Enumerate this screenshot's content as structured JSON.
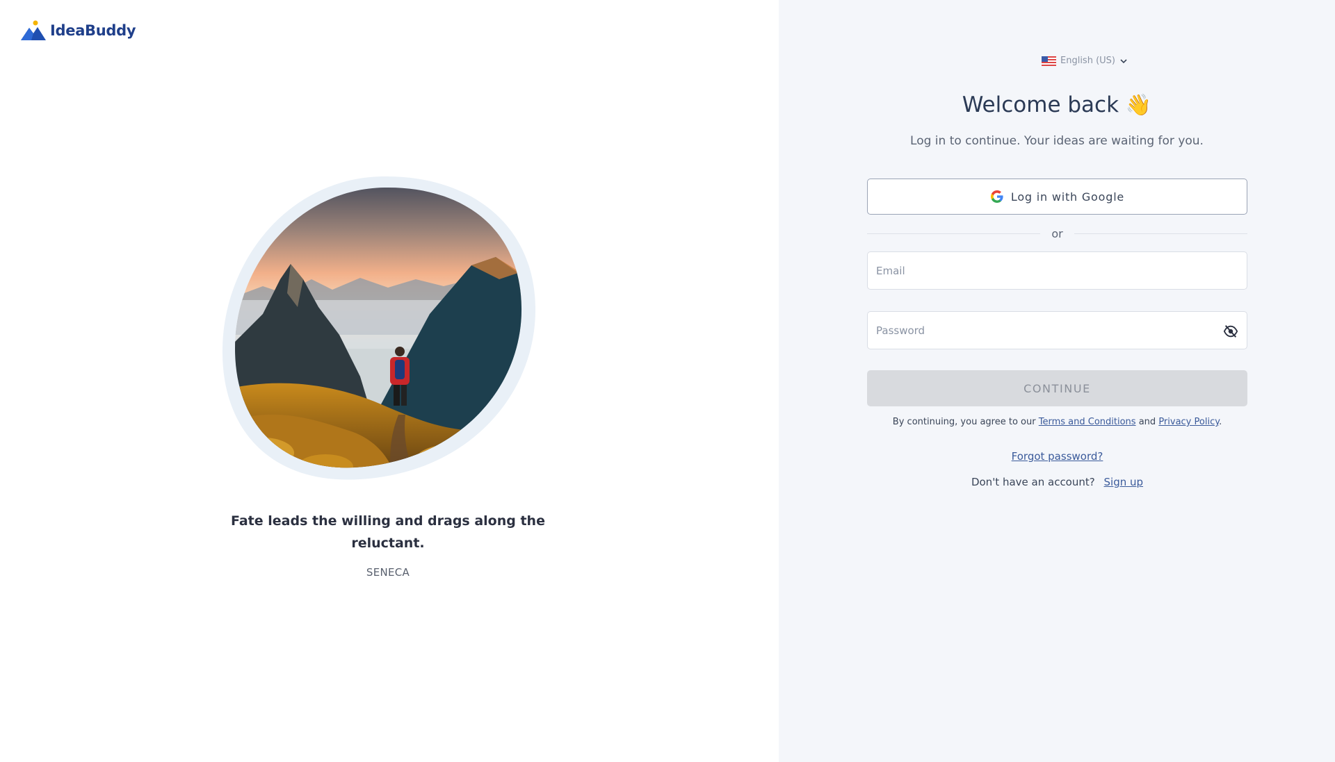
{
  "brand": {
    "name": "IdeaBuddy",
    "color": "#1f3f8a",
    "accent": "#f5b400"
  },
  "quote": {
    "text": "Fate leads the willing and drags along the reluctant.",
    "author": "SENECA"
  },
  "login": {
    "language": {
      "label": "English (US)",
      "flag_icon": "us-flag-icon"
    },
    "title": "Welcome back",
    "title_emoji": "👋",
    "subtitle": "Log in to continue. Your ideas are waiting for you.",
    "google_button": "Log in with Google",
    "divider_text": "or",
    "email": {
      "placeholder": "Email",
      "value": ""
    },
    "password": {
      "placeholder": "Password",
      "value": ""
    },
    "continue_button": "CONTINUE",
    "terms": {
      "prefix": "By continuing, you agree to our",
      "terms_link": "Terms and Conditions",
      "middle": "and",
      "privacy_link": "Privacy Policy",
      "suffix": "."
    },
    "forgot_password": "Forgot password?",
    "signup": {
      "prompt": "Don't have an account?",
      "link": "Sign up"
    }
  },
  "colors": {
    "right_panel_bg": "#f4f6fa",
    "disabled_button_bg": "#d8dade",
    "link": "#3a5a9a"
  }
}
